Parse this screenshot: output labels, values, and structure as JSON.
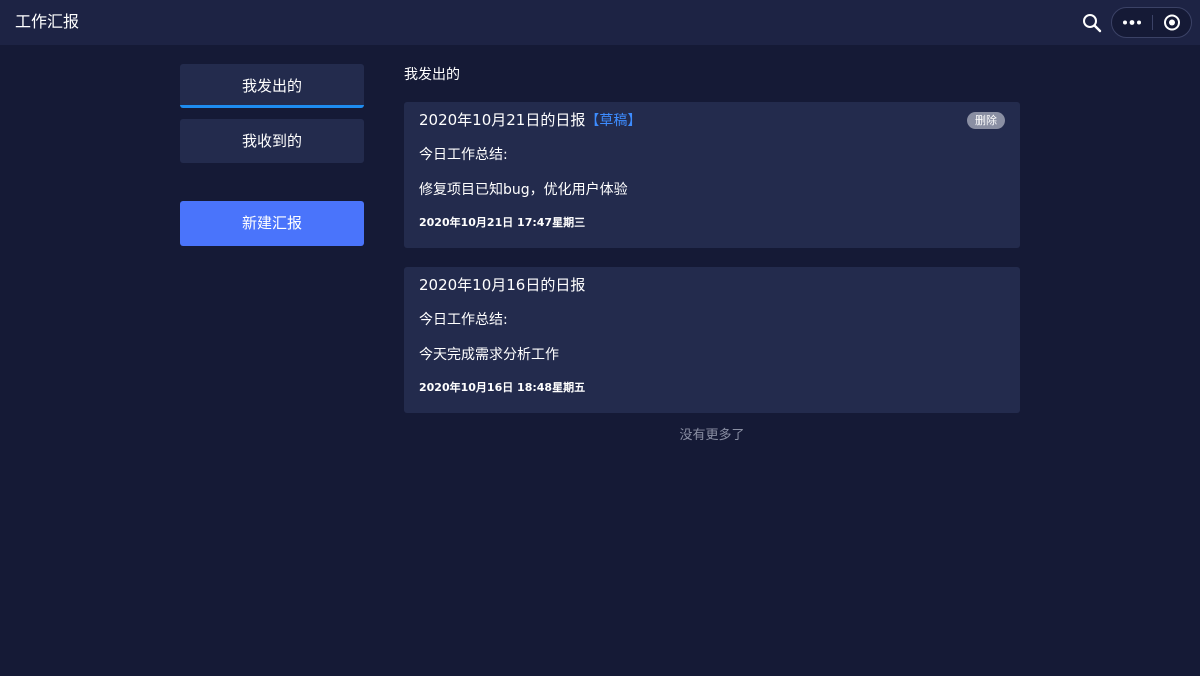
{
  "header": {
    "title": "工作汇报",
    "icons": {
      "search": "search-icon",
      "more": "more-dots-icon",
      "close": "circle-target-icon"
    }
  },
  "sidebar": {
    "tabs": [
      {
        "label": "我发出的",
        "active": true
      },
      {
        "label": "我收到的",
        "active": false
      }
    ],
    "new_button_label": "新建汇报"
  },
  "main": {
    "section_title": "我发出的",
    "reports": [
      {
        "title": "2020年10月21日的日报",
        "tag": "【草稿】",
        "summary_label": "今日工作总结:",
        "summary_text": "修复项目已知bug，优化用户体验",
        "time": "2020年10月21日 17:47星期三",
        "delete_label": "删除"
      },
      {
        "title": "2020年10月16日的日报",
        "tag": "",
        "summary_label": "今日工作总结:",
        "summary_text": "今天完成需求分析工作",
        "time": "2020年10月16日 18:48星期五",
        "delete_label": ""
      }
    ],
    "no_more_text": "没有更多了"
  },
  "colors": {
    "background": "#151a36",
    "header_bg": "#1d2344",
    "card_bg": "#232b4d",
    "accent_blue": "#4a74fb",
    "tab_underline": "#1e8cf0",
    "draft_tag": "#3d8cff",
    "muted_text": "#8a8fa3"
  }
}
